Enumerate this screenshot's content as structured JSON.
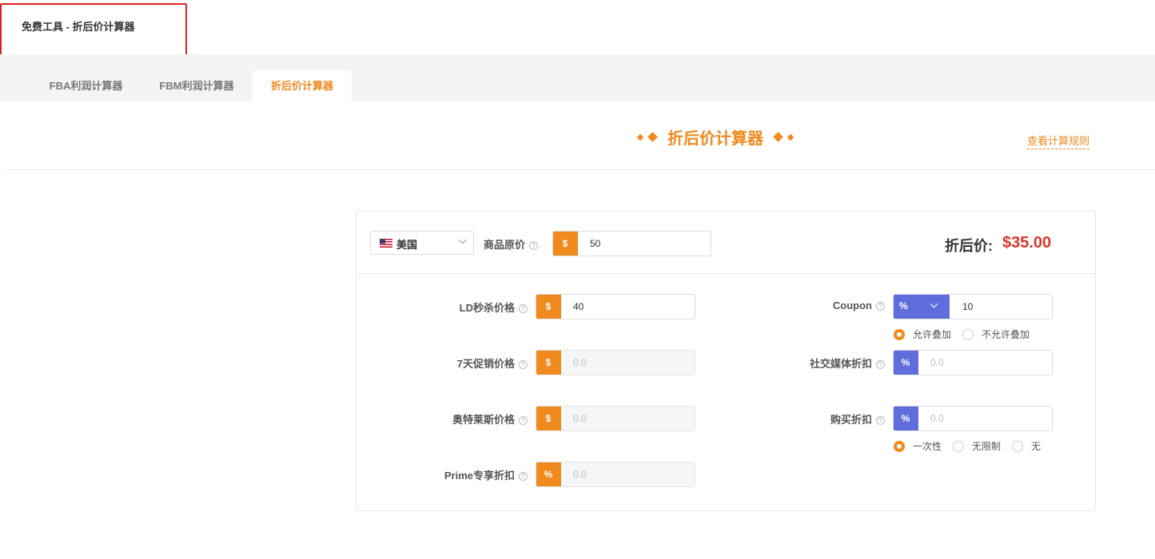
{
  "breadcrumb": "免费工具 - 折后价计算器",
  "tabs": [
    {
      "label": "FBA利润计算器"
    },
    {
      "label": "FBM利润计算器"
    },
    {
      "label": "折后价计算器"
    }
  ],
  "page_title": "折后价计算器",
  "rules_link": "查看计算规则",
  "colors": {
    "accent": "#f0891e",
    "percent": "#5f6edc",
    "result": "#d9352b"
  },
  "country": {
    "flag_icon": "us-flag-icon",
    "value": "美国"
  },
  "original_price": {
    "label": "商品原价",
    "prefix": "$",
    "value": "50"
  },
  "result": {
    "label": "折后价:",
    "value": "$35.00"
  },
  "left_fields": [
    {
      "label": "LD秒杀价格",
      "prefix": "$",
      "value": "40"
    },
    {
      "label": "7天促销价格",
      "prefix": "$",
      "placeholder": "0.0"
    },
    {
      "label": "奥特莱斯价格",
      "prefix": "$",
      "placeholder": "0.0"
    },
    {
      "label": "Prime专享折扣",
      "prefix": "%",
      "placeholder": "0.0"
    }
  ],
  "coupon": {
    "label": "Coupon",
    "type_value": "%",
    "value": "10",
    "stacking_options": [
      "允许叠加",
      "不允许叠加"
    ],
    "stacking_selected": "允许叠加"
  },
  "social_discount": {
    "label": "社交媒体折扣",
    "prefix": "%",
    "placeholder": "0.0"
  },
  "purchase_discount": {
    "label": "购买折扣",
    "prefix": "%",
    "placeholder": "0.0",
    "options": [
      "一次性",
      "无限制",
      "无"
    ],
    "selected": "一次性"
  },
  "help_glyph": "?"
}
